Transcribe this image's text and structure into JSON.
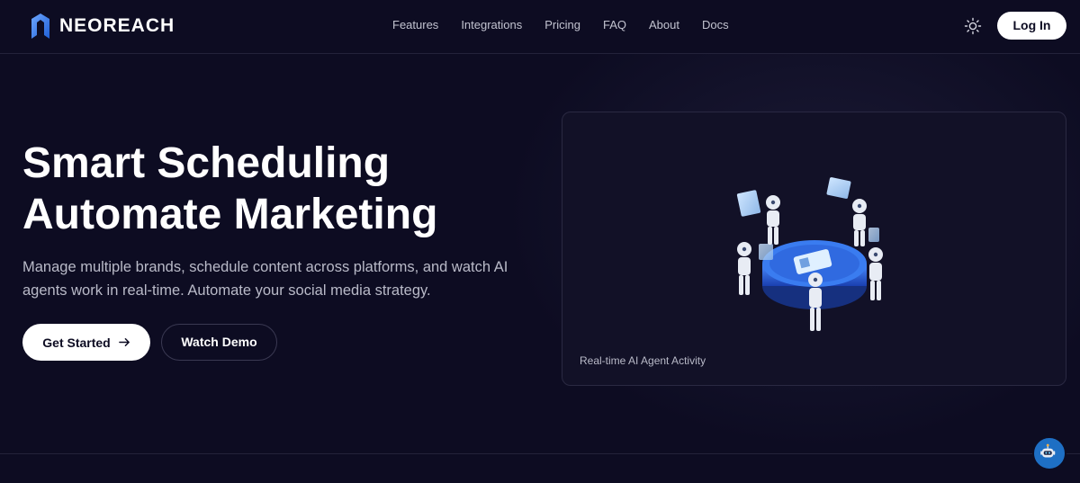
{
  "brand": {
    "name": "NEOREACH"
  },
  "nav": {
    "items": [
      {
        "label": "Features"
      },
      {
        "label": "Integrations"
      },
      {
        "label": "Pricing"
      },
      {
        "label": "FAQ"
      },
      {
        "label": "About"
      },
      {
        "label": "Docs"
      }
    ]
  },
  "header": {
    "theme_icon": "sun-icon",
    "login_label": "Log In"
  },
  "hero": {
    "title_line1": "Smart Scheduling",
    "title_line2": "Automate Marketing",
    "description": "Manage multiple brands, schedule content across platforms, and watch AI agents work in real-time. Automate your social media strategy.",
    "primary_cta": "Get Started",
    "primary_cta_icon": "arrow-right-icon",
    "secondary_cta": "Watch Demo"
  },
  "activity_card": {
    "caption": "Real-time AI Agent Activity",
    "illustration": "ai-robots-around-platform-illustration"
  },
  "chat_widget": {
    "icon": "robot-chat-icon"
  },
  "colors": {
    "background": "#0d0c22",
    "card": "#121127",
    "accent": "#1e6fc4",
    "text_muted": "#b9bac8"
  }
}
